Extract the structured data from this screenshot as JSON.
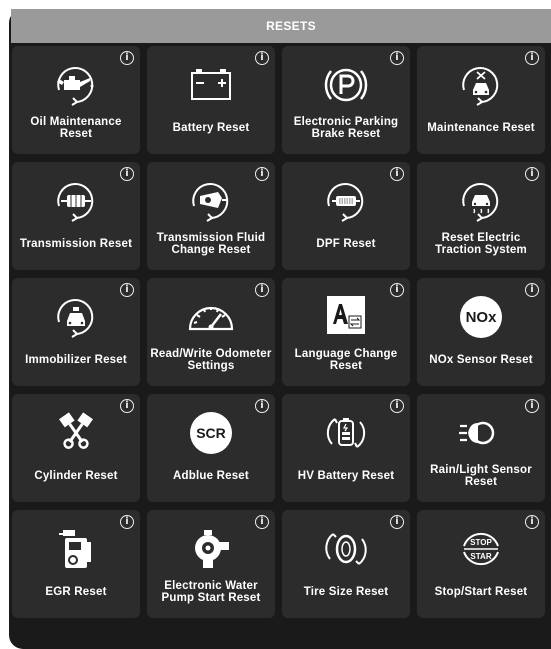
{
  "header": {
    "title": "RESETS"
  },
  "colors": {
    "panel_bg": "#1a1a1a",
    "tile_bg": "#2c2c2c",
    "header_bg": "#9a9a9a",
    "text": "#ffffff"
  },
  "info_glyph": "i",
  "tiles": [
    {
      "label": "Oil Maintenance Reset",
      "icon": "oil-can-icon"
    },
    {
      "label": "Battery Reset",
      "icon": "battery-icon"
    },
    {
      "label": "Electronic Parking Brake Reset",
      "icon": "parking-brake-icon"
    },
    {
      "label": "Maintenance Reset",
      "icon": "car-service-icon"
    },
    {
      "label": "Transmission Reset",
      "icon": "transmission-icon"
    },
    {
      "label": "Transmission Fluid Change Reset",
      "icon": "transmission-fluid-icon"
    },
    {
      "label": "DPF Reset",
      "icon": "dpf-filter-icon"
    },
    {
      "label": "Reset Electric Traction System",
      "icon": "traction-control-icon"
    },
    {
      "label": "Immobilizer Reset",
      "icon": "immobilizer-icon"
    },
    {
      "label": "Read/Write Odometer Settings",
      "icon": "odometer-icon"
    },
    {
      "label": "Language Change Reset",
      "icon": "language-icon"
    },
    {
      "label": "NOx Sensor Reset",
      "icon": "nox-icon",
      "icon_text": "NOx"
    },
    {
      "label": "Cylinder Reset",
      "icon": "pistons-icon"
    },
    {
      "label": "Adblue Reset",
      "icon": "scr-icon",
      "icon_text": "SCR"
    },
    {
      "label": "HV Battery Reset",
      "icon": "hv-battery-icon"
    },
    {
      "label": "Rain/Light Sensor Reset",
      "icon": "headlight-icon"
    },
    {
      "label": "EGR Reset",
      "icon": "egr-valve-icon"
    },
    {
      "label": "Electronic Water Pump Start Reset",
      "icon": "water-pump-icon"
    },
    {
      "label": "Tire Size Reset",
      "icon": "tire-icon"
    },
    {
      "label": "Stop/Start Reset",
      "icon": "stop-start-icon",
      "icon_text_top": "STOP",
      "icon_text_bottom": "STAR"
    }
  ]
}
